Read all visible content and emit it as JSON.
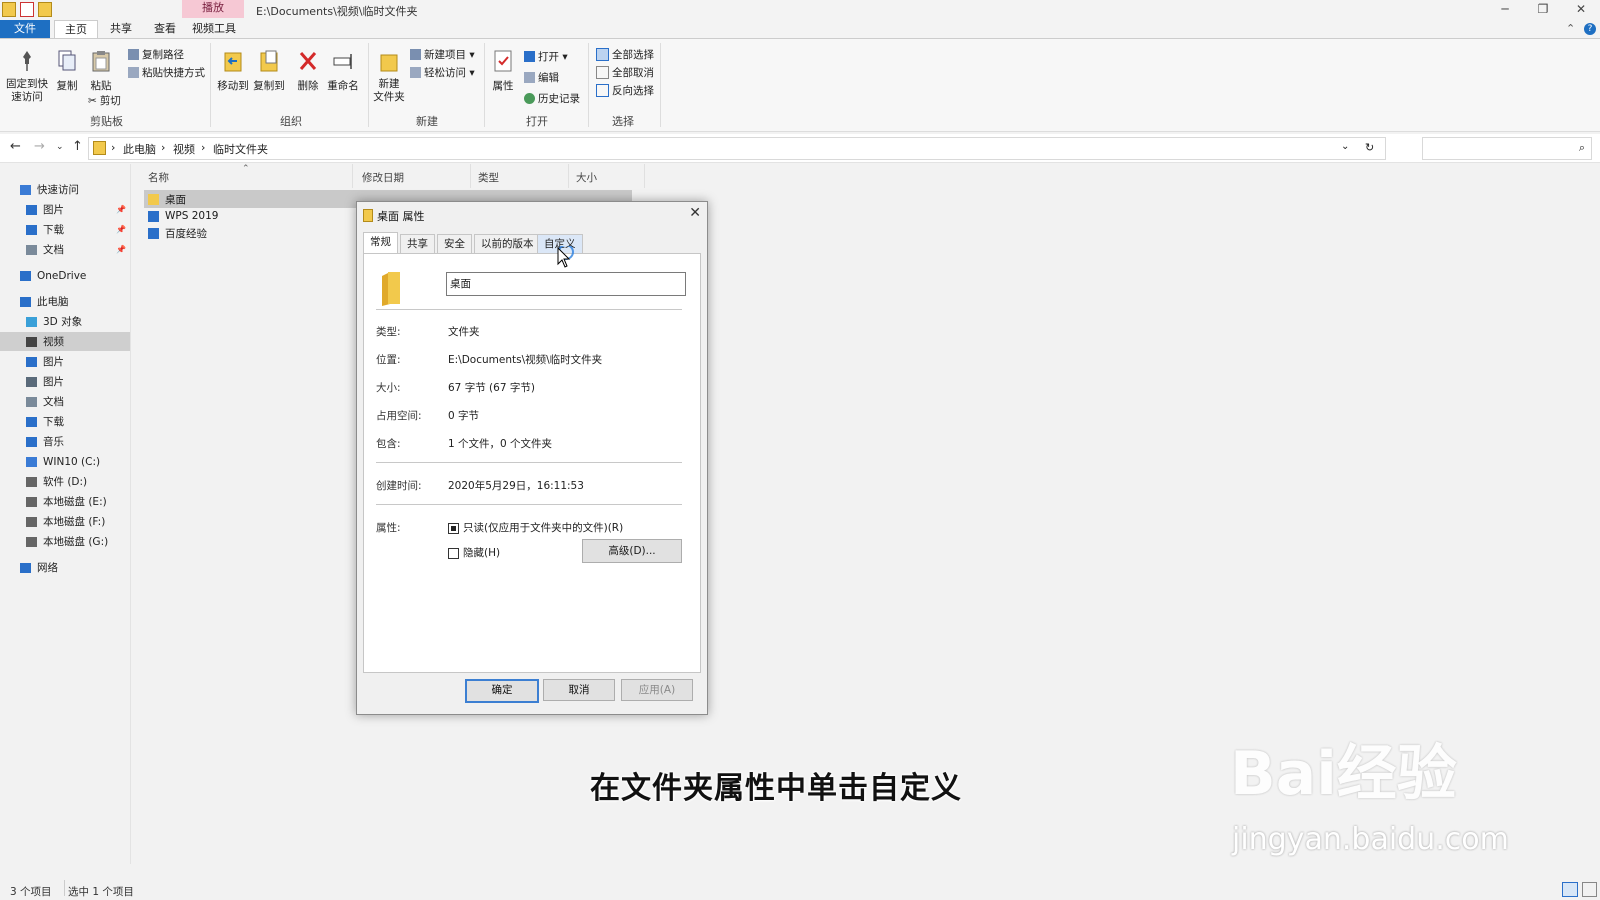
{
  "window": {
    "context_tab": "播放",
    "path_title": "E:\\Documents\\视频\\临时文件夹",
    "controls": [
      "─",
      "❐",
      "✕"
    ]
  },
  "ribbon_tabs": [
    "文件",
    "主页",
    "共享",
    "查看",
    "视频工具"
  ],
  "ribbon": {
    "clipboard": {
      "pin": "固定到快\n速访问",
      "copy": "复制",
      "paste": "粘贴",
      "copy_path": "复制路径",
      "paste_shortcut": "粘贴快捷方式",
      "cut": "剪切",
      "label": "剪贴板"
    },
    "organize": {
      "move_to": "移动到",
      "copy_to": "复制到",
      "delete": "删除",
      "rename": "重命名",
      "label": "组织"
    },
    "new": {
      "new_folder": "新建\n文件夹",
      "new_item": "新建项目 ▾",
      "easy_access": "轻松访问 ▾",
      "label": "新建"
    },
    "open": {
      "properties": "属性",
      "open": "打开 ▾",
      "edit": "编辑",
      "history": "历史记录",
      "label": "打开"
    },
    "select": {
      "select_all": "全部选择",
      "select_none": "全部取消",
      "invert": "反向选择",
      "label": "选择"
    }
  },
  "address": {
    "crumbs": [
      "此电脑",
      "视频",
      "临时文件夹"
    ]
  },
  "nav": [
    {
      "label": "快速访问",
      "level": 0,
      "color": "#3a7bd5"
    },
    {
      "label": "图片",
      "level": 1,
      "color": "#2a6fc9",
      "pin": "📌"
    },
    {
      "label": "下载",
      "level": 1,
      "color": "#2a6fc9",
      "pin": "📌"
    },
    {
      "label": "文档",
      "level": 1,
      "color": "#7a8a9a",
      "pin": "📌"
    },
    {
      "label": "OneDrive",
      "level": 0,
      "color": "#2a6fc9"
    },
    {
      "label": "此电脑",
      "level": 0,
      "color": "#2a6fc9"
    },
    {
      "label": "3D 对象",
      "level": 1,
      "color": "#3aa0d8"
    },
    {
      "label": "视频",
      "level": 1,
      "color": "#444",
      "selected": true
    },
    {
      "label": "图片",
      "level": 1,
      "color": "#2a6fc9"
    },
    {
      "label": "图片",
      "level": 1,
      "color": "#5a6a7a"
    },
    {
      "label": "文档",
      "level": 1,
      "color": "#7a8a9a"
    },
    {
      "label": "下载",
      "level": 1,
      "color": "#2a6fc9"
    },
    {
      "label": "音乐",
      "level": 1,
      "color": "#2a6fc9"
    },
    {
      "label": "WIN10 (C:)",
      "level": 1,
      "color": "#3a7bd5"
    },
    {
      "label": "软件 (D:)",
      "level": 1,
      "color": "#666"
    },
    {
      "label": "本地磁盘 (E:)",
      "level": 1,
      "color": "#666"
    },
    {
      "label": "本地磁盘 (F:)",
      "level": 1,
      "color": "#666"
    },
    {
      "label": "本地磁盘 (G:)",
      "level": 1,
      "color": "#666"
    },
    {
      "label": "网络",
      "level": 0,
      "color": "#2a6fc9"
    }
  ],
  "columns": [
    "名称",
    "修改日期",
    "类型",
    "大小"
  ],
  "files": [
    {
      "name": "桌面",
      "icon_color": "#f2c94c",
      "selected": true
    },
    {
      "name": "WPS 2019",
      "icon_color": "#2a6fc9"
    },
    {
      "name": "百度经验",
      "icon_color": "#2a6fc9"
    }
  ],
  "status": {
    "count": "3 个项目",
    "selected": "选中 1 个项目"
  },
  "dialog": {
    "title": "桌面 属性",
    "tabs": [
      "常规",
      "共享",
      "安全",
      "以前的版本",
      "自定义"
    ],
    "name_value": "桌面",
    "rows": [
      {
        "label": "类型:",
        "value": "文件夹"
      },
      {
        "label": "位置:",
        "value": "E:\\Documents\\视频\\临时文件夹"
      },
      {
        "label": "大小:",
        "value": "67 字节 (67 字节)"
      },
      {
        "label": "占用空间:",
        "value": "0 字节"
      },
      {
        "label": "包含:",
        "value": "1 个文件，0 个文件夹"
      }
    ],
    "created_label": "创建时间:",
    "created_value": "2020年5月29日，16:11:53",
    "attr_label": "属性:",
    "readonly": "只读(仅应用于文件夹中的文件)(R)",
    "hidden": "隐藏(H)",
    "advanced": "高级(D)...",
    "ok": "确定",
    "cancel": "取消",
    "apply": "应用(A)"
  },
  "caption": "在文件夹属性中单击自定义",
  "watermark": {
    "brand": "Bai经验",
    "url": "jingyan.baidu.com"
  }
}
